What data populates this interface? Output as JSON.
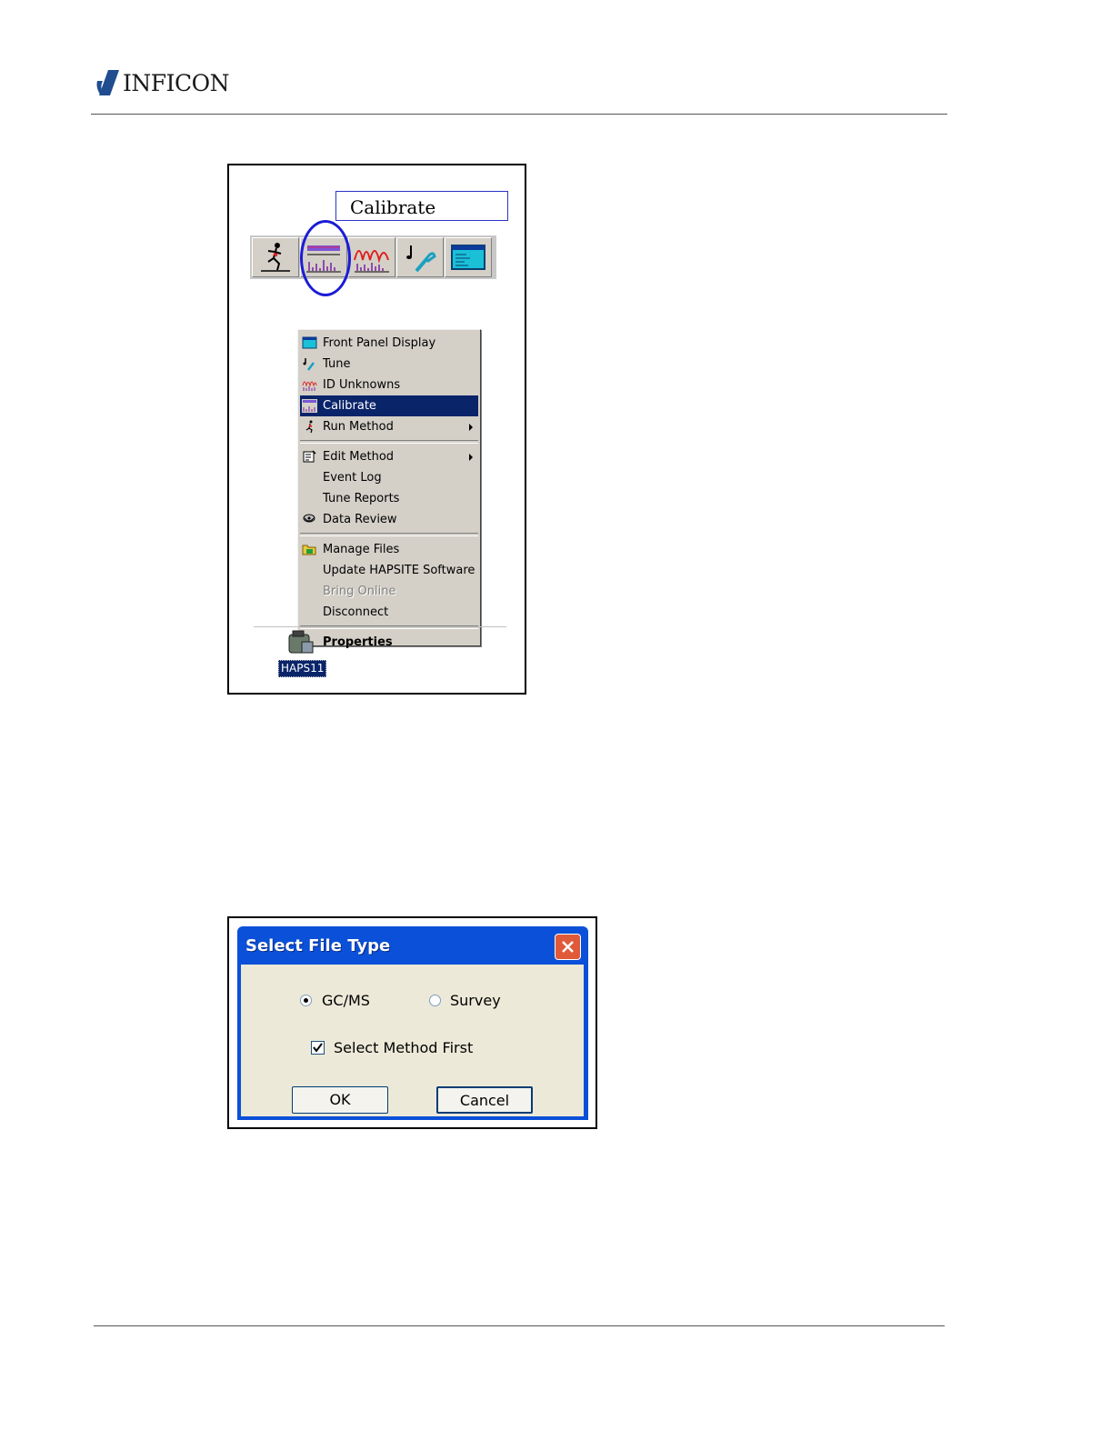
{
  "header": {
    "brand": "INFICON"
  },
  "figure1": {
    "tooltip": "Calibrate",
    "toolbar": [
      {
        "name": "run-method",
        "icon": "running-man-icon"
      },
      {
        "name": "calibrate",
        "icon": "calibrate-spectrum-icon"
      },
      {
        "name": "id-unknowns",
        "icon": "peaks-spectrum-icon"
      },
      {
        "name": "tune",
        "icon": "tune-fork-icon"
      },
      {
        "name": "front-panel",
        "icon": "front-panel-display-icon"
      }
    ],
    "menu": {
      "items": [
        {
          "label": "Front Panel Display"
        },
        {
          "label": "Tune"
        },
        {
          "label": "ID Unknowns"
        },
        {
          "label": "Calibrate"
        },
        {
          "label": "Run Method"
        },
        {
          "label": "Edit Method"
        },
        {
          "label": "Event Log"
        },
        {
          "label": "Tune Reports"
        },
        {
          "label": "Data Review"
        },
        {
          "label": "Manage Files"
        },
        {
          "label": "Update HAPSITE Software"
        },
        {
          "label": "Bring Online"
        },
        {
          "label": "Disconnect"
        },
        {
          "label": "Properties"
        }
      ]
    },
    "desktop_icon": {
      "label": "HAPS11"
    }
  },
  "figure2": {
    "title": "Select File Type",
    "radio_gcms": "GC/MS",
    "radio_survey": "Survey",
    "checkbox_label": "Select Method First",
    "ok": "OK",
    "cancel": "Cancel"
  },
  "colors": {
    "menu_highlight": "#0a246a",
    "xp_title_blue": "#0a50d8",
    "circle_blue": "#1c1cd6"
  }
}
